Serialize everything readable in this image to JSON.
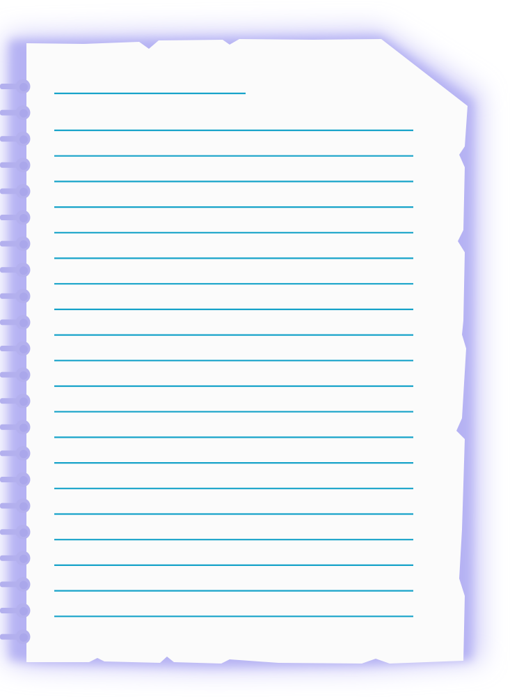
{
  "page": {
    "description_visible_text": ""
  },
  "colors": {
    "glow": "#b9b6f6",
    "glow_soft": "#dcdaf9",
    "paper": "#fbfbfb",
    "rule_line": "#17a3c9",
    "ring_hole": "#b3b0ee",
    "ring_hole_dark": "#9c98e6"
  },
  "icons": {
    "spiral_hole": "spiral-hole-icon"
  },
  "ruled_lines": {
    "short_top_line_count": 1,
    "full_line_count": 20
  },
  "spiral": {
    "hole_count": 22
  }
}
